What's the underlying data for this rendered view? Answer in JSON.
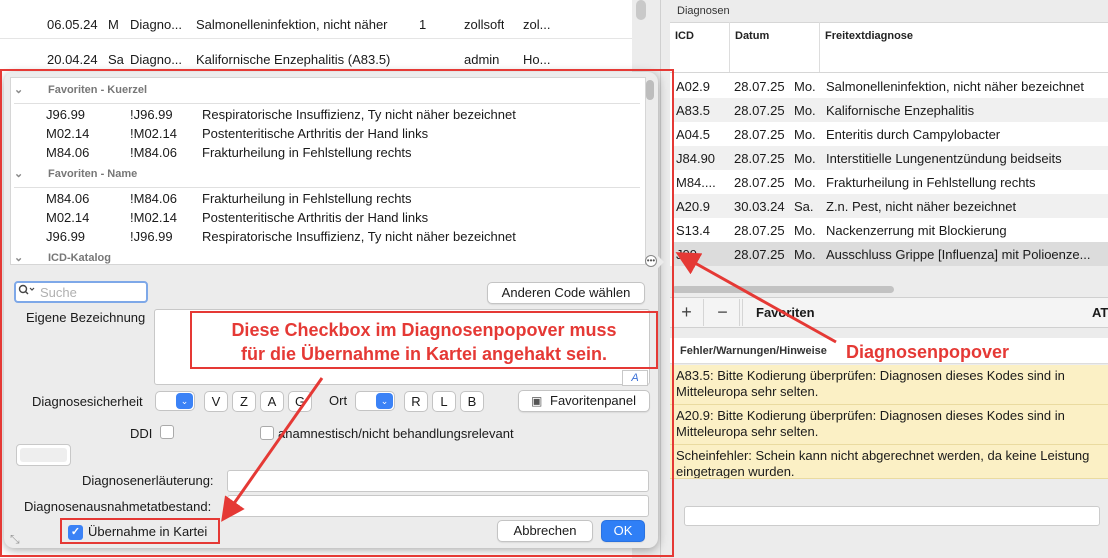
{
  "bg_rows": [
    {
      "date": "06.05.24",
      "d": "M",
      "c": "Diagno...",
      "text": "Salmonelleninfektion, nicht näher",
      "num": "1",
      "user": "zollsoft",
      "x": "zol..."
    },
    {
      "date": "20.04.24",
      "d": "Sa",
      "c": "Diagno...",
      "text": "Kalifornische Enzephalitis (A83.5)",
      "num": "",
      "user": "admin",
      "x": "Ho..."
    }
  ],
  "diagnosen": {
    "title": "Diagnosen",
    "headers": {
      "icd": "ICD",
      "datum": "Datum",
      "frei": "Freitextdiagnose"
    },
    "rows": [
      {
        "icd": "A02.9",
        "date": "28.07.25",
        "day": "Mo.",
        "text": "Salmonelleninfektion, nicht näher bezeichnet"
      },
      {
        "icd": "A83.5",
        "date": "28.07.25",
        "day": "Mo.",
        "text": "Kalifornische Enzephalitis"
      },
      {
        "icd": "A04.5",
        "date": "28.07.25",
        "day": "Mo.",
        "text": "Enteritis durch Campylobacter"
      },
      {
        "icd": "J84.90",
        "date": "28.07.25",
        "day": "Mo.",
        "text": "Interstitielle Lungenentzündung beidseits"
      },
      {
        "icd": "M84....",
        "date": "28.07.25",
        "day": "Mo.",
        "text": "Frakturheilung in Fehlstellung rechts"
      },
      {
        "icd": "A20.9",
        "date": "30.03.24",
        "day": "Sa.",
        "text": "Z.n. Pest, nicht näher bezeichnet"
      },
      {
        "icd": "S13.4",
        "date": "28.07.25",
        "day": "Mo.",
        "text": "Nackenzerrung mit Blockierung"
      },
      {
        "icd": "J09",
        "date": "28.07.25",
        "day": "Mo.",
        "text": "Ausschluss Grippe [Influenza] mit Polioenze..."
      }
    ],
    "toolbar": {
      "add": "+",
      "remove": "−",
      "favoriten": "Favoriten",
      "at": "AT"
    }
  },
  "warnings": {
    "title": "Fehler/Warnungen/Hinweise",
    "items": [
      "A83.5: Bitte Kodierung überprüfen: Diagnosen dieses Kodes sind in Mitteleuropa sehr selten.",
      "A20.9: Bitte Kodierung überprüfen: Diagnosen dieses Kodes sind in Mitteleuropa sehr selten.",
      "Scheinfehler: Schein kann nicht abgerechnet werden, da keine Leistung eingetragen wurden."
    ]
  },
  "popover": {
    "sections": {
      "kuerzel": "Favoriten - Kuerzel",
      "name": "Favoriten - Name",
      "katalog": "ICD-Katalog"
    },
    "kuerzel_rows": [
      {
        "code": "J96.99",
        "short": "!J96.99",
        "text": "Respiratorische Insuffizienz, Ty nicht näher bezeichnet"
      },
      {
        "code": "M02.14",
        "short": "!M02.14",
        "text": "Postenteritische Arthritis der Hand links"
      },
      {
        "code": "M84.06",
        "short": "!M84.06",
        "text": "Frakturheilung in Fehlstellung rechts"
      }
    ],
    "name_rows": [
      {
        "code": "M84.06",
        "short": "!M84.06",
        "text": "Frakturheilung in Fehlstellung rechts"
      },
      {
        "code": "M02.14",
        "short": "!M02.14",
        "text": "Postenteritische Arthritis der Hand links"
      },
      {
        "code": "J96.99",
        "short": "!J96.99",
        "text": "Respiratorische Insuffizienz, Ty nicht näher bezeichnet"
      }
    ],
    "search_placeholder": "Suche",
    "other_code": "Anderen Code wählen",
    "eigene": "Eigene Bezeichnung",
    "font_button": "A",
    "sicherheit": "Diagnosesicherheit",
    "sicherheit_letters": [
      "V",
      "Z",
      "A",
      "G"
    ],
    "ort": "Ort",
    "ort_letters": [
      "R",
      "L",
      "B"
    ],
    "favoritenpanel": "Favoritenpanel",
    "ddi": "DDI",
    "anamnestisch": "anamnestisch/nicht behandlungsrelevant",
    "erlaeuterung": "Diagnosenerläuterung:",
    "ausnahme": "Diagnosenausnahmetatbestand:",
    "uebernahme": "Übernahme in Kartei",
    "abbrechen": "Abbrechen",
    "ok": "OK"
  },
  "annotations": {
    "callout_line1": "Diese Checkbox im Diagnosenpopover muss",
    "callout_line2": "für die Übernahme in Kartei angehakt sein.",
    "popover_label": "Diagnosenpopover",
    "color": "#e53935"
  }
}
